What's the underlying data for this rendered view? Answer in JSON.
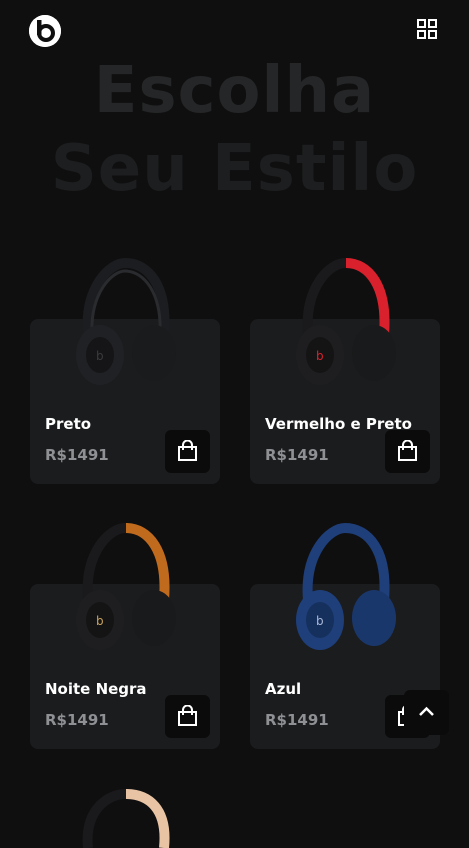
{
  "header": {
    "logo_icon": "beats-logo-icon",
    "menu_icon": "grid-icon"
  },
  "hero": {
    "line1": "Escolha",
    "line2": "Seu Estilo"
  },
  "products": [
    {
      "name": "Preto",
      "price": "R$1491",
      "cart_icon": "shopping-bag-icon",
      "colors": {
        "band": "#1c1d20",
        "accent": "#2a2b2e"
      }
    },
    {
      "name": "Vermelho e Preto",
      "price": "R$1491",
      "cart_icon": "shopping-bag-icon",
      "colors": {
        "band": "#d8212c",
        "accent": "#1a1a1c"
      }
    },
    {
      "name": "Noite Negra",
      "price": "R$1491",
      "cart_icon": "shopping-bag-icon",
      "colors": {
        "band": "#c06a1e",
        "accent": "#1a1a1c"
      }
    },
    {
      "name": "Azul",
      "price": "R$1491",
      "cart_icon": "shopping-bag-icon",
      "colors": {
        "band": "#1f3f7a",
        "accent": "#16305e"
      }
    }
  ],
  "back_to_top": {
    "icon": "chevron-up-icon"
  },
  "colors": {
    "background": "#0f0f10",
    "card": "#1b1c1e",
    "hero_text": "#252627",
    "price_text": "#8f9094"
  }
}
